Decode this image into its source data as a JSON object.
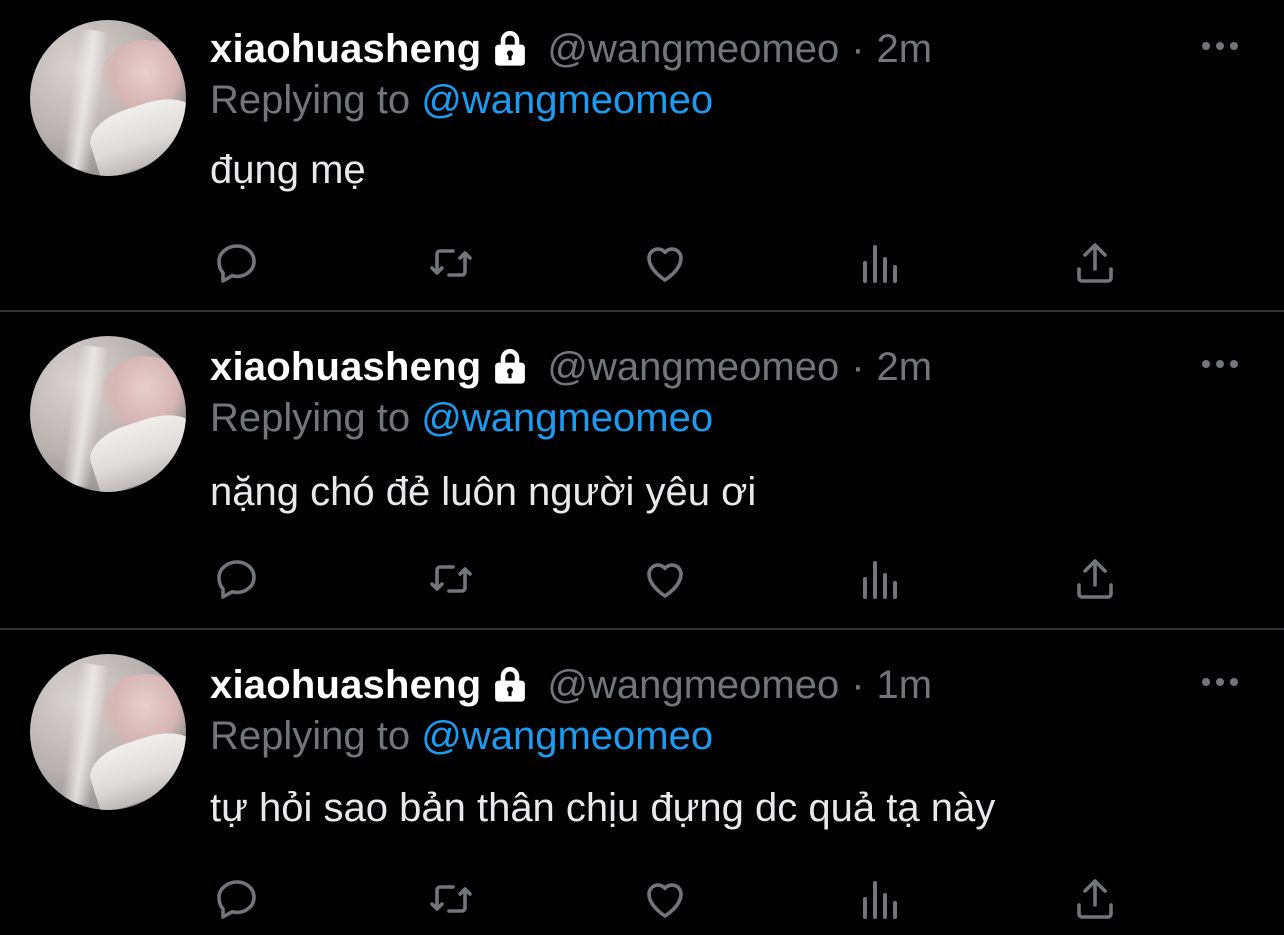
{
  "tweets": [
    {
      "display_name": "xiaohuasheng",
      "handle": "@wangmeomeo",
      "separator": "·",
      "time": "2m",
      "reply_prefix": "Replying to",
      "reply_handle": "@wangmeomeo",
      "text": "đụng mẹ"
    },
    {
      "display_name": "xiaohuasheng",
      "handle": "@wangmeomeo",
      "separator": "·",
      "time": "2m",
      "reply_prefix": "Replying to",
      "reply_handle": "@wangmeomeo",
      "text": "nặng chó đẻ luôn người yêu ơi"
    },
    {
      "display_name": "xiaohuasheng",
      "handle": "@wangmeomeo",
      "separator": "·",
      "time": "1m",
      "reply_prefix": "Replying to",
      "reply_handle": "@wangmeomeo",
      "text": "tự hỏi sao bản thân chịu đựng dc quả tạ này"
    }
  ],
  "icons": {
    "lock": "lock-icon",
    "more": "more-icon",
    "reply": "reply-icon",
    "retweet": "retweet-icon",
    "like": "heart-icon",
    "analytics": "analytics-icon",
    "share": "share-icon"
  },
  "colors": {
    "background": "#000000",
    "text": "#e7e9ea",
    "secondary": "#71767b",
    "link": "#1d9bf0",
    "divider": "#2f3336"
  }
}
